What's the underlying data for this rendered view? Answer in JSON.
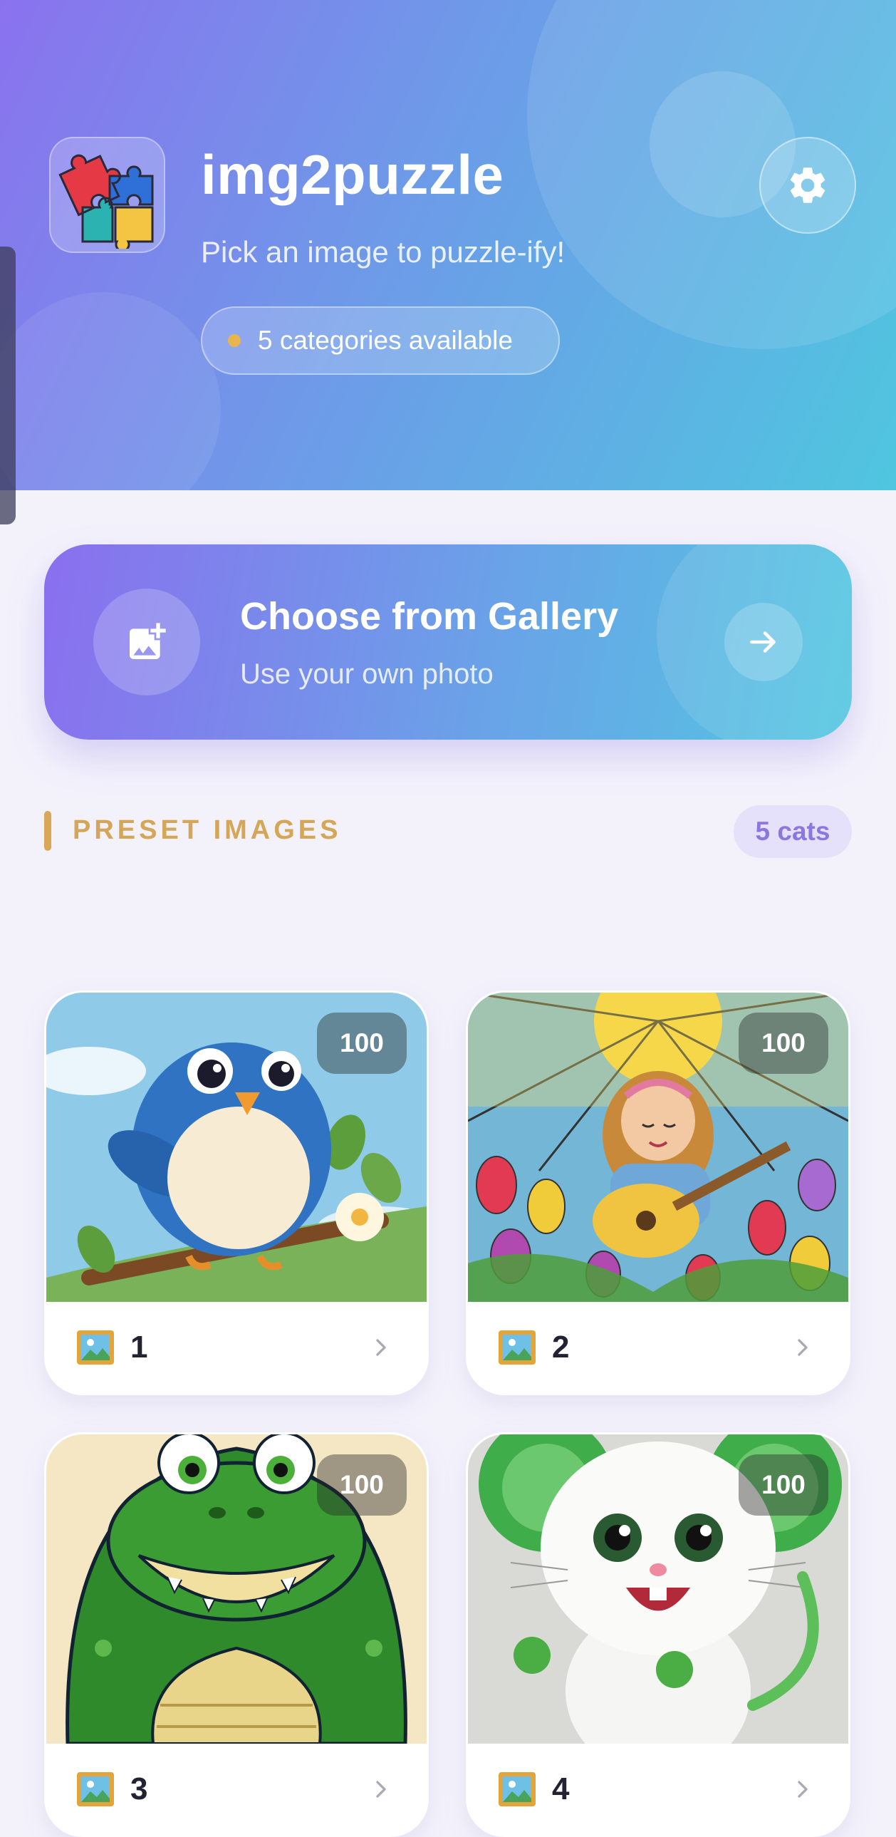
{
  "header": {
    "title": "img2puzzle",
    "subtitle": "Pick an image to puzzle-ify!",
    "categories_pill": "5 categories available",
    "app_icon": "puzzle-icon",
    "settings_icon": "gear-icon"
  },
  "gallery": {
    "title": "Choose from Gallery",
    "subtitle": "Use your own photo",
    "icon": "add-photo-icon",
    "arrow_icon": "arrow-right-icon"
  },
  "section": {
    "title": "PRESET IMAGES",
    "badge": "5 cats"
  },
  "cards": [
    {
      "label": "1",
      "count": "100",
      "image": "blue bird on branch"
    },
    {
      "label": "2",
      "count": "100",
      "image": "stained glass girl with guitar"
    },
    {
      "label": "3",
      "count": "100",
      "image": "green crocodile"
    },
    {
      "label": "4",
      "count": "100",
      "image": "white mouse"
    }
  ],
  "colors": {
    "header_start": "#8a72ee",
    "header_end": "#4fc6df",
    "accent_gold": "#d4a657",
    "badge_purple": "#8c76e2"
  }
}
